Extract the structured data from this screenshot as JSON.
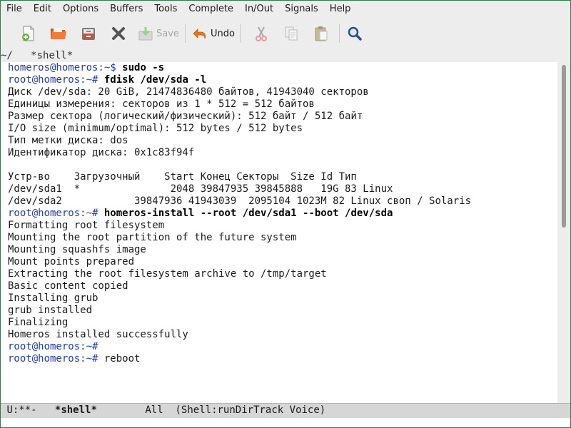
{
  "menubar": {
    "items": [
      "File",
      "Edit",
      "Options",
      "Buffers",
      "Tools",
      "Complete",
      "In/Out",
      "Signals",
      "Help"
    ]
  },
  "toolbar": {
    "new_icon": "new-file-icon",
    "open_icon": "open-folder-icon",
    "dired_icon": "file-cabinet-icon",
    "close_icon": "close-x-icon",
    "save_label": "Save",
    "undo_label": "Undo",
    "cut_icon": "scissors-icon",
    "copy_icon": "copy-icon",
    "paste_icon": "paste-icon",
    "search_icon": "search-icon"
  },
  "header": {
    "path": "~/",
    "buffer": "*shell*"
  },
  "terminal": {
    "lines": [
      {
        "prompt": "homeros@homeros:~$",
        "cmd": "sudo -s",
        "bold": true
      },
      {
        "prompt": "root@homeros:~#",
        "cmd": "fdisk /dev/sda -l",
        "bold": true
      },
      {
        "text": "Диск /dev/sda: 20 GiB, 21474836480 байтов, 41943040 секторов"
      },
      {
        "text": "Единицы измерения: секторов из 1 * 512 = 512 байтов"
      },
      {
        "text": "Размер сектора (логический/физический): 512 байт / 512 байт"
      },
      {
        "text": "I/O size (minimum/optimal): 512 bytes / 512 bytes"
      },
      {
        "text": "Тип метки диска: dos"
      },
      {
        "text": "Идентификатор диска: 0x1c83f94f"
      },
      {
        "text": ""
      },
      {
        "text": "Устр-во    Загрузочный    Start Конец Секторы  Size Id Тип"
      },
      {
        "text": "/dev/sda1  *               2048 39847935 39845888   19G 83 Linux"
      },
      {
        "text": "/dev/sda2            39847936 41943039  2095104 1023M 82 Linux своп / Solaris"
      },
      {
        "prompt": "root@homeros:~#",
        "cmd": "homeros-install --root /dev/sda1 --boot /dev/sda",
        "bold": true
      },
      {
        "text": "Formatting root filesystem"
      },
      {
        "text": "Mounting the root partition of the future system"
      },
      {
        "text": "Mounting squashfs image"
      },
      {
        "text": "Mount points prepared"
      },
      {
        "text": "Extracting the root filesystem archive to /tmp/target"
      },
      {
        "text": "Basic content copied"
      },
      {
        "text": "Installing grub"
      },
      {
        "text": "grub installed"
      },
      {
        "text": "Finalizing"
      },
      {
        "text": "Homeros installed successfully"
      },
      {
        "prompt": "root@homeros:~#",
        "cmd": ""
      },
      {
        "prompt": "root@homeros:~#",
        "cmd": "reboot",
        "bold": false
      }
    ]
  },
  "modeline": {
    "status": "U:**-",
    "buffer": "*shell*",
    "position": "All",
    "mode": "(Shell:runDirTrack Voice)"
  },
  "colors": {
    "prompt": "#1f3cb5",
    "border": "#2e7d4a"
  }
}
